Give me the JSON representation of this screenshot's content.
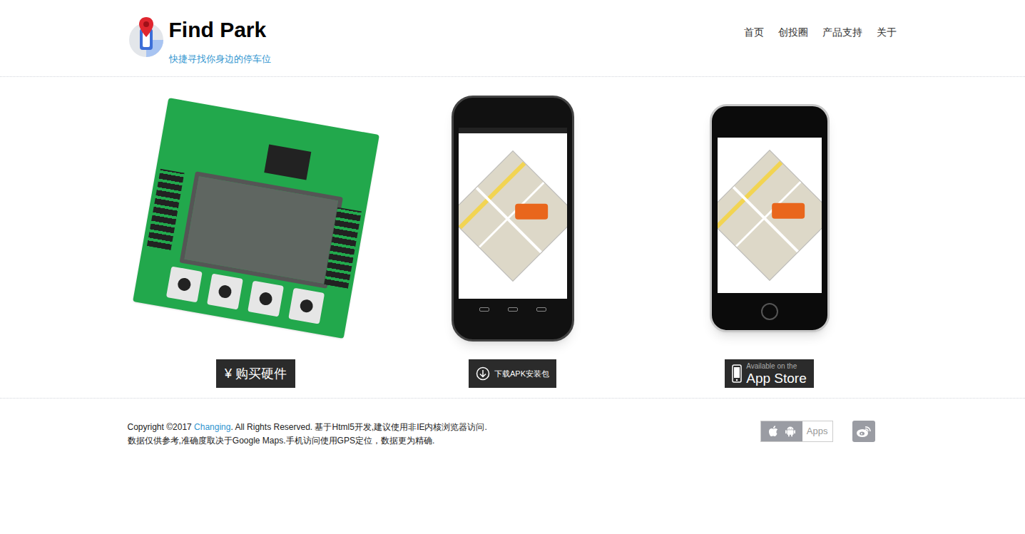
{
  "header": {
    "title": "Find Park",
    "subtitle": "快捷寻找你身边的停车位"
  },
  "nav": [
    {
      "label": "首页"
    },
    {
      "label": "创投圈"
    },
    {
      "label": "产品支持"
    },
    {
      "label": "关于"
    }
  ],
  "products": [
    {
      "kind": "hardware",
      "button": {
        "lines": [
          "¥ 购买硬件"
        ]
      }
    },
    {
      "kind": "android",
      "button": {
        "lines": [
          "下载APK安装包"
        ]
      }
    },
    {
      "kind": "iphone",
      "button": {
        "lines": [
          "Available on the",
          "App Store"
        ]
      }
    }
  ],
  "footer": {
    "copyright_prefix": "Copyright ©2017 ",
    "link": "Changing",
    "copyright_suffix": ". All Rights Reserved. 基于Html5开发,建议使用非IE内核浏览器访问.",
    "line2": "数据仅供参考,准确度取决于Google Maps.手机访问使用GPS定位，数据更为精确.",
    "apps_label": "Apps"
  }
}
